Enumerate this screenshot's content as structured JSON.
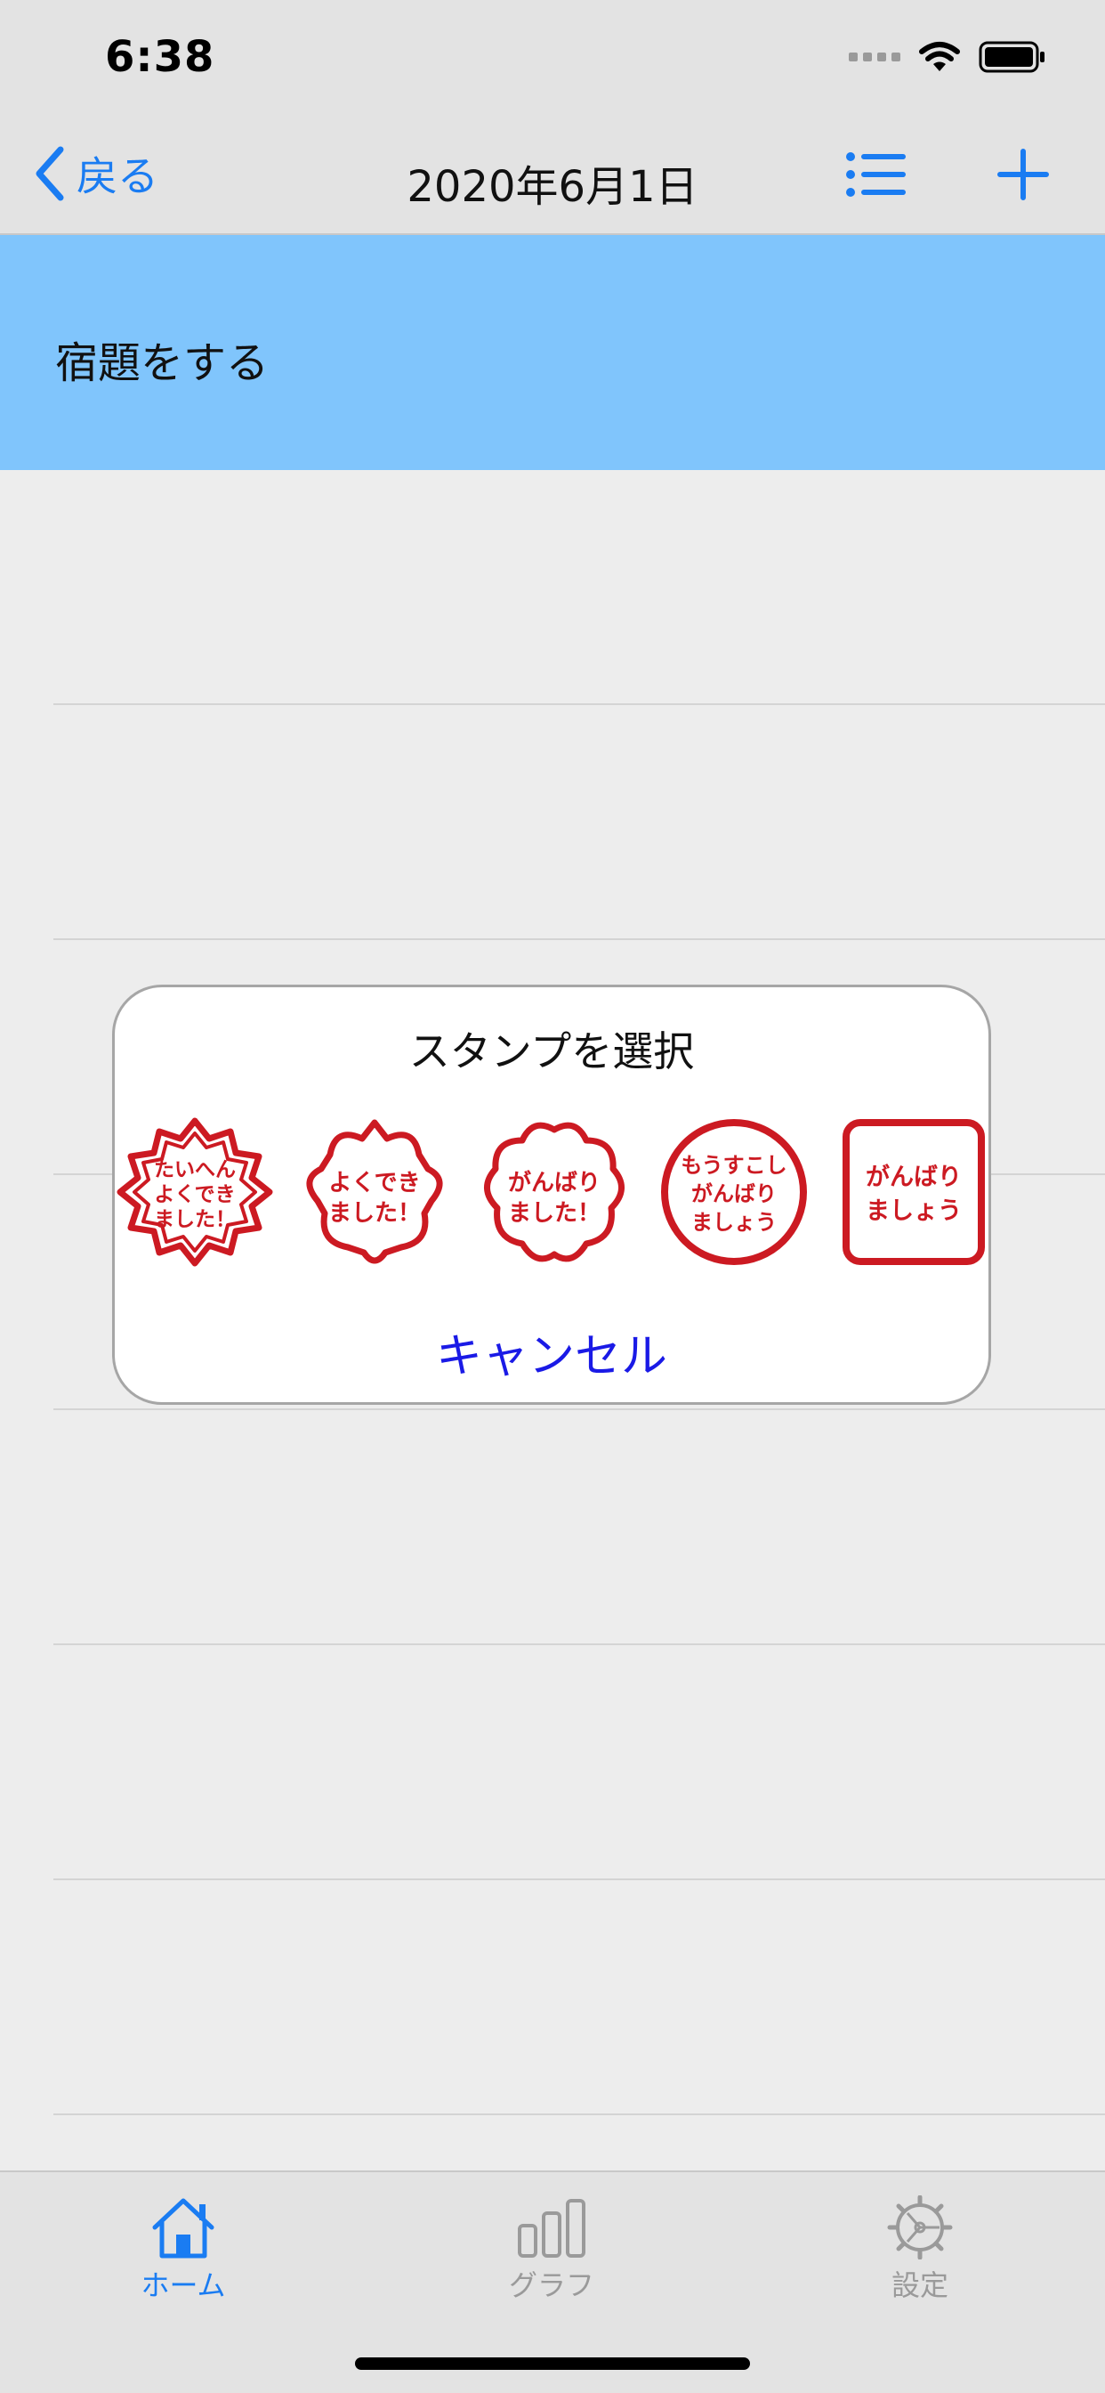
{
  "status": {
    "time": "6:38"
  },
  "nav": {
    "back_label": "戻る",
    "title": "2020年6月1日"
  },
  "task": {
    "label": "宿題をする"
  },
  "dialog": {
    "title": "スタンプを選択",
    "cancel_label": "キャンセル",
    "stamps": [
      {
        "lines": [
          "たいへん",
          "よくでき",
          "ました！"
        ]
      },
      {
        "lines": [
          "よくでき",
          "ました！"
        ]
      },
      {
        "lines": [
          "がんばり",
          "ました！"
        ]
      },
      {
        "lines": [
          "もうすこし",
          "がんばり",
          "ましょう"
        ]
      },
      {
        "lines": [
          "がんばり",
          "ましょう"
        ]
      }
    ]
  },
  "tabs": [
    {
      "label": "ホーム",
      "icon": "home-icon",
      "active": true
    },
    {
      "label": "グラフ",
      "icon": "graph-icon",
      "active": false
    },
    {
      "label": "設定",
      "icon": "gear-icon",
      "active": false
    }
  ],
  "colors": {
    "accent": "#1a7cf2",
    "task_bg": "#80c5fc",
    "stamp_red": "#cc1a22",
    "inactive": "#9a9a9a",
    "cancel": "#1a1ae6"
  }
}
